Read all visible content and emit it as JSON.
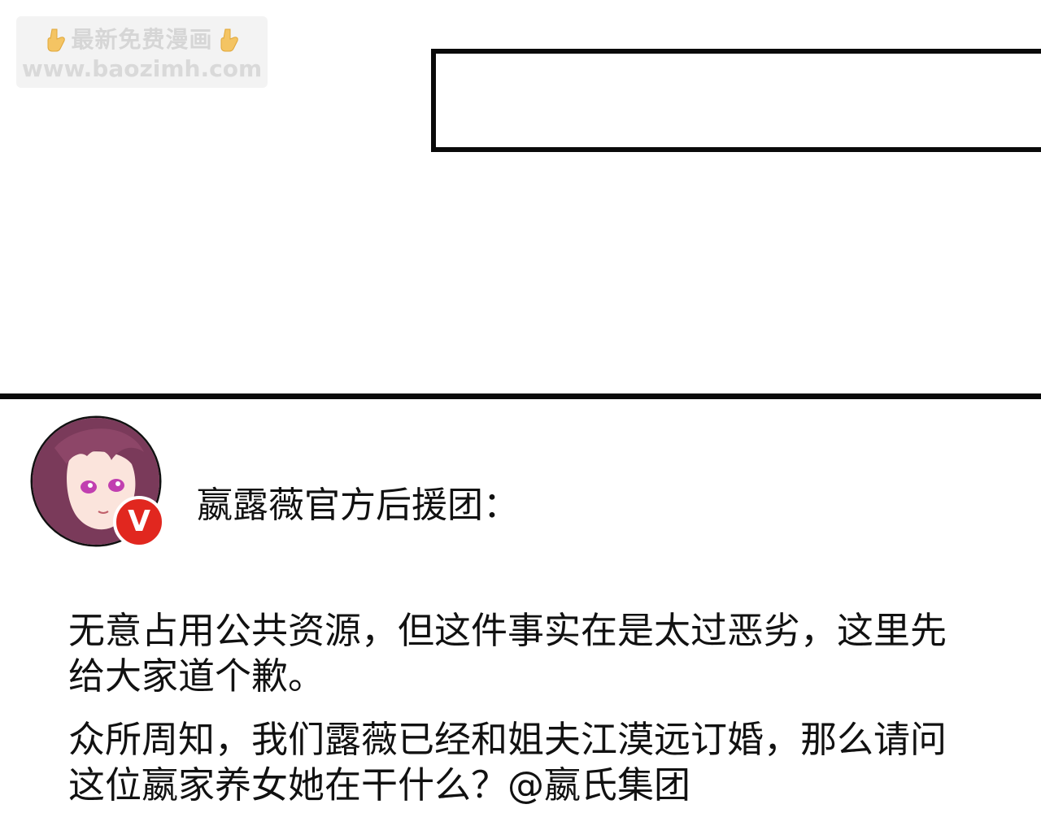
{
  "watermark": {
    "line1": "最新免费漫画",
    "line2": "www.baozimh.com",
    "icon_left": "pointing-down-hand-icon",
    "icon_right": "pointing-down-hand-icon"
  },
  "post": {
    "author": "嬴露薇官方后援团：",
    "badge": "V",
    "badge_color": "#e1271f",
    "paragraphs": [
      "无意占用公共资源，但这件事实在是太过恶劣，这里先给大家道个歉。",
      "众所周知，我们露薇已经和姐夫江漠远订婚，那么请问这位嬴家养女她在干什么？@嬴氏集团"
    ]
  }
}
